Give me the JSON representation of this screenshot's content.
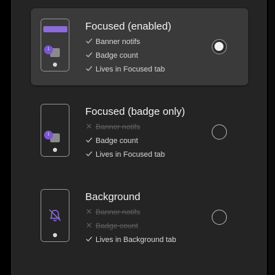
{
  "options": [
    {
      "title": "Focused (enabled)",
      "selected": true,
      "features": [
        {
          "label": "Banner notifs",
          "enabled": true
        },
        {
          "label": "Badge count",
          "enabled": true
        },
        {
          "label": "Lives in Focused tab",
          "enabled": true
        }
      ],
      "illustration": {
        "banner": true,
        "badge_text": "1",
        "bell_muted": false
      }
    },
    {
      "title": "Focused (badge only)",
      "selected": false,
      "features": [
        {
          "label": "Banner notifs",
          "enabled": false
        },
        {
          "label": "Badge count",
          "enabled": true
        },
        {
          "label": "Lives in Focused tab",
          "enabled": true
        }
      ],
      "illustration": {
        "banner": false,
        "badge_text": "1",
        "bell_muted": false
      }
    },
    {
      "title": "Background",
      "selected": false,
      "features": [
        {
          "label": "Banner notifs",
          "enabled": false
        },
        {
          "label": "Badge count",
          "enabled": false
        },
        {
          "label": "Lives in Background tab",
          "enabled": true
        }
      ],
      "illustration": {
        "banner": false,
        "badge_text": "",
        "bell_muted": true
      }
    }
  ],
  "icons": {
    "enabled_mark": "check-icon",
    "disabled_mark": "cross-icon",
    "muted_bell": "bell-off-icon"
  },
  "colors": {
    "accent": "#8b6cd9",
    "badge": "#7a56d2",
    "panel": "#242424",
    "selected_card": "#3a3a3a",
    "text": "#f2f2f2",
    "muted_text": "#5e5e5e"
  }
}
